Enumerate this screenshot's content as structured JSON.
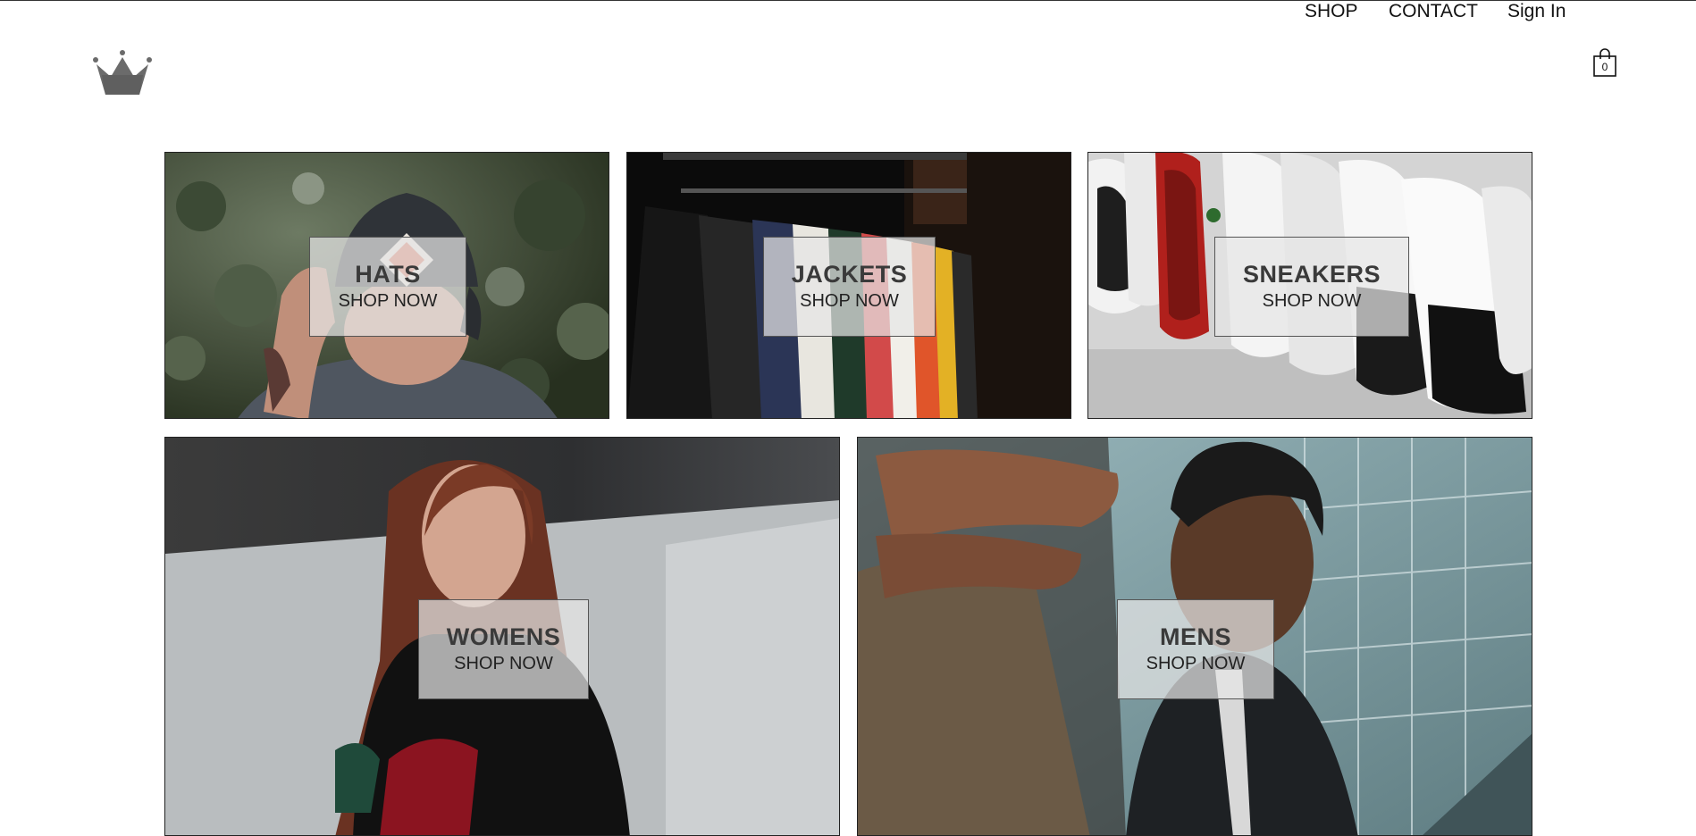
{
  "header": {
    "logo_icon": "crown-icon",
    "nav": {
      "shop": "SHOP",
      "contact": "CONTACT",
      "sign_in": "Sign In"
    },
    "cart": {
      "icon": "shopping-bag-icon",
      "count": "0"
    }
  },
  "categories": [
    {
      "title": "HATS",
      "cta": "SHOP NOW"
    },
    {
      "title": "JACKETS",
      "cta": "SHOP NOW"
    },
    {
      "title": "SNEAKERS",
      "cta": "SHOP NOW"
    },
    {
      "title": "WOMENS",
      "cta": "SHOP NOW"
    },
    {
      "title": "MENS",
      "cta": "SHOP NOW"
    }
  ],
  "colors": {
    "text": "#111111",
    "overlay": "#e6e6e6",
    "logo": "#6b6b6b"
  }
}
